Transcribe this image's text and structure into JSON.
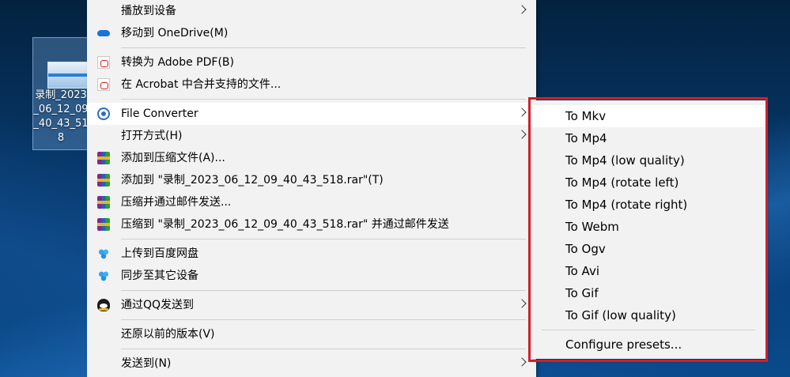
{
  "desktop": {
    "file_label": "录制_2023_06_12_09_40_43_518"
  },
  "context_menu": {
    "items": [
      {
        "label": "播放到设备"
      },
      {
        "label": "移动到 OneDrive(M)"
      },
      {
        "label": "转换为 Adobe PDF(B)"
      },
      {
        "label": "在 Acrobat 中合并支持的文件..."
      },
      {
        "label": "File Converter"
      },
      {
        "label": "打开方式(H)"
      },
      {
        "label": "添加到压缩文件(A)..."
      },
      {
        "label": "添加到 \"录制_2023_06_12_09_40_43_518.rar\"(T)"
      },
      {
        "label": "压缩并通过邮件发送..."
      },
      {
        "label": "压缩到 \"录制_2023_06_12_09_40_43_518.rar\" 并通过邮件发送"
      },
      {
        "label": "上传到百度网盘"
      },
      {
        "label": "同步至其它设备"
      },
      {
        "label": "通过QQ发送到"
      },
      {
        "label": "还原以前的版本(V)"
      },
      {
        "label": "发送到(N)"
      }
    ]
  },
  "file_converter_submenu": {
    "items": [
      {
        "label": "To Mkv"
      },
      {
        "label": "To Mp4"
      },
      {
        "label": "To Mp4 (low quality)"
      },
      {
        "label": "To Mp4 (rotate left)"
      },
      {
        "label": "To Mp4 (rotate right)"
      },
      {
        "label": "To Webm"
      },
      {
        "label": "To Ogv"
      },
      {
        "label": "To Avi"
      },
      {
        "label": "To Gif"
      },
      {
        "label": "To Gif (low quality)"
      },
      {
        "label": "Configure presets..."
      }
    ]
  },
  "colors": {
    "highlight_frame": "#d0202a",
    "menu_bg": "#f2f2f2",
    "hover_bg": "#ffffff"
  },
  "icons": {
    "onedrive": "cloud-icon",
    "adobe_pdf": "pdf-icon",
    "acrobat": "acrobat-icon",
    "file_converter": "file-converter-icon",
    "winrar": "winrar-icon",
    "baidu": "baidu-netdisk-icon",
    "qq": "qq-icon",
    "submenu": "chevron-right-icon"
  }
}
